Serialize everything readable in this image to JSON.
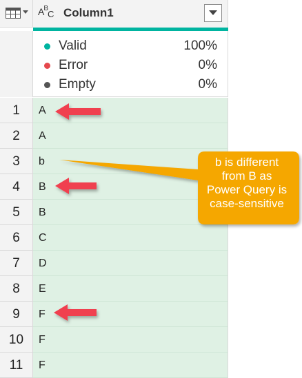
{
  "column": {
    "type_icon": "ABC",
    "title": "Column1"
  },
  "quality": {
    "valid": {
      "label": "Valid",
      "percent": "100%",
      "color": "#00b4a0"
    },
    "error": {
      "label": "Error",
      "percent": "0%",
      "color": "#e5484d"
    },
    "empty": {
      "label": "Empty",
      "percent": "0%",
      "color": "#555555"
    }
  },
  "rows": [
    {
      "num": "1",
      "value": "A"
    },
    {
      "num": "2",
      "value": "A"
    },
    {
      "num": "3",
      "value": "b"
    },
    {
      "num": "4",
      "value": "B"
    },
    {
      "num": "5",
      "value": "B"
    },
    {
      "num": "6",
      "value": "C"
    },
    {
      "num": "7",
      "value": "D"
    },
    {
      "num": "8",
      "value": "E"
    },
    {
      "num": "9",
      "value": "F"
    },
    {
      "num": "10",
      "value": "F"
    },
    {
      "num": "11",
      "value": "F"
    }
  ],
  "callout": {
    "lines": [
      "b is different",
      "from B as",
      "Power Query is",
      "case-sensitive"
    ],
    "color": "#f5a700"
  },
  "arrow_color": "#f04050"
}
